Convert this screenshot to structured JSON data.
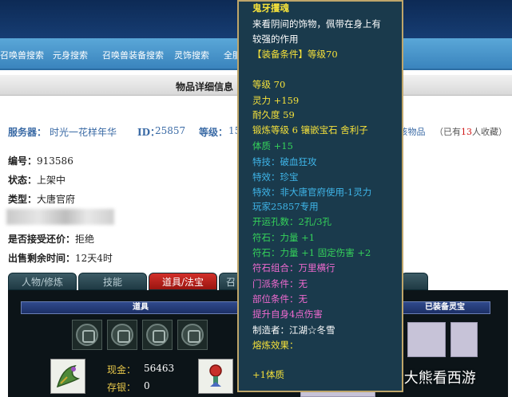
{
  "nav": {
    "items": [
      "召唤兽搜索",
      "元身搜索",
      "召唤兽装备搜索",
      "灵饰搜索",
      "全服"
    ]
  },
  "title": "物品详细信息",
  "info": {
    "server_label": "服务器：",
    "server_value": "时光一花样年华",
    "id_label": "ID：",
    "id_value": "25857",
    "level_label": "等级：",
    "level_value": "15",
    "fav_text": "收藏该物品",
    "fav_prefix": "（已有",
    "fav_count": "13",
    "fav_suffix": "人收藏）"
  },
  "details": {
    "number_label": "编号：",
    "number_value": "913586",
    "status_label": "状态：",
    "status_value": "上架中",
    "type_label": "类型：",
    "type_value": "大唐官府",
    "bargain_label": "是否接受还价：",
    "bargain_value": "拒绝",
    "remaining_label": "出售剩余时间：",
    "remaining_value": "12天4时"
  },
  "tabs": [
    "人物/修炼",
    "技能",
    "道具/法宝",
    "召"
  ],
  "panel": {
    "items_header": "道具",
    "equipped_header": "已装备灵宝",
    "cash_label": "现金：",
    "cash_value": "56463",
    "savings_label": "存银：",
    "savings_value": "0"
  },
  "tooltip": {
    "name": "鬼牙攫魂",
    "desc1": "来看阴间的饰物，佩带在身上有",
    "desc2": "较强的作用",
    "req": "【装备条件】等级70",
    "lines": [
      {
        "text": "等级 70",
        "color": "yellow"
      },
      {
        "text": "灵力 +159",
        "color": "yellow"
      },
      {
        "text": "耐久度 59",
        "color": "yellow"
      },
      {
        "text": "锻炼等级 6 镶嵌宝石 舍利子",
        "color": "yellow"
      },
      {
        "text": "体质 +15",
        "color": "green"
      },
      {
        "text": "特技：破血狂攻",
        "color": "blue"
      },
      {
        "text": "特效：珍宝",
        "color": "blue"
      },
      {
        "text": "特效：非大唐官府使用-1灵力",
        "color": "blue"
      },
      {
        "text": "玩家25857专用",
        "color": "blue"
      },
      {
        "text": "开运孔数：2孔/3孔",
        "color": "green"
      },
      {
        "text": "符石：力量 +1",
        "color": "green"
      },
      {
        "text": "符石：力量 +1 固定伤害 +2",
        "color": "green"
      },
      {
        "text": "符石组合：万里横行",
        "color": "pink"
      },
      {
        "text": "门派条件：无",
        "color": "pink"
      },
      {
        "text": "部位条件：无",
        "color": "pink"
      },
      {
        "text": "提升自身4点伤害",
        "color": "pink"
      },
      {
        "text": "制造者：江湖☆冬雪",
        "color": "white"
      },
      {
        "text": "熔炼效果：",
        "color": "yellow"
      },
      {
        "text": "",
        "color": "yellow"
      },
      {
        "text": "+1体质",
        "color": "yellow"
      }
    ]
  },
  "watermark": "企鹅号 大熊看西游",
  "icons": {
    "slot": "swirl-emblem-icon",
    "item1": "dragon-item-icon",
    "item2": "ornament-item-icon"
  }
}
